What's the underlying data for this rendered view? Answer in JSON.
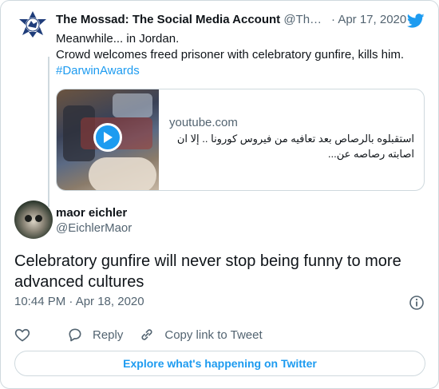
{
  "parent_tweet": {
    "name": "The Mossad: The Social Media Account",
    "handle": "@Th…",
    "date": "· Apr 17, 2020",
    "lines": [
      "Meanwhile... in Jordan.",
      "Crowd welcomes freed prisoner with celebratory gunfire, kills him."
    ],
    "hashtag": "#DarwinAwards",
    "link_card": {
      "domain": "youtube.com",
      "description": "استقبلوه بالرصاص بعد تعافيه من فيروس كورونا .. إلا ان اصابته رصاصه عن..."
    }
  },
  "tweet": {
    "name": "maor eichler",
    "handle": "@EichlerMaor",
    "text": "Celebratory gunfire will never stop being funny to more advanced cultures",
    "timestamp": "10:44 PM · Apr 18, 2020"
  },
  "actions": {
    "reply": "Reply",
    "copy_link": "Copy link to Tweet"
  },
  "explore_button": "Explore what's happening on Twitter",
  "colors": {
    "accent": "#1d9bf0",
    "muted": "#536471",
    "border": "#cfd9de",
    "text": "#0f1419"
  },
  "icons": [
    "mossad-emblem-icon",
    "twitter-bird-icon",
    "play-icon",
    "info-icon",
    "heart-icon",
    "reply-icon",
    "link-icon"
  ]
}
